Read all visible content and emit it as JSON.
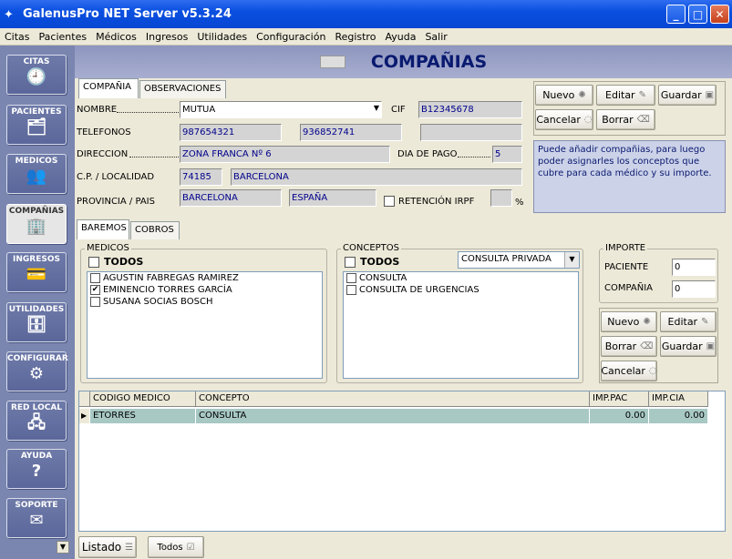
{
  "window": {
    "title": "GalenusPro NET Server v5.3.24"
  },
  "menu": [
    "Citas",
    "Pacientes",
    "Médicos",
    "Ingresos",
    "Utilidades",
    "Configuración",
    "Registro",
    "Ayuda",
    "Salir"
  ],
  "sidebar": [
    {
      "label": "CITAS",
      "icon": "clock-icon",
      "glyph": "🕘"
    },
    {
      "label": "PACIENTES",
      "icon": "patients-icon",
      "glyph": "🗂"
    },
    {
      "label": "MEDICOS",
      "icon": "doctors-icon",
      "glyph": "👥"
    },
    {
      "label": "COMPAÑIAS",
      "icon": "building-icon",
      "glyph": "🏢"
    },
    {
      "label": "INGRESOS",
      "icon": "money-icon",
      "glyph": "💳"
    },
    {
      "label": "UTILIDADES",
      "icon": "utilities-icon",
      "glyph": "🗄"
    },
    {
      "label": "CONFIGURAR",
      "icon": "gears-icon",
      "glyph": "⚙"
    },
    {
      "label": "RED LOCAL",
      "icon": "network-icon",
      "glyph": "🖧"
    },
    {
      "label": "AYUDA",
      "icon": "help-icon",
      "glyph": "?"
    },
    {
      "label": "SOPORTE",
      "icon": "support-icon",
      "glyph": "✉"
    }
  ],
  "header": {
    "title": "COMPAÑIAS"
  },
  "tabs_top": [
    "COMPAÑIA",
    "OBSERVACIONES"
  ],
  "form": {
    "nombre_label": "NOMBRE",
    "nombre": "MUTUA",
    "cif_label": "CIF",
    "cif": "B12345678",
    "telefonos_label": "TELEFONOS",
    "tel1": "987654321",
    "tel2": "936852741",
    "tel3": "",
    "direccion_label": "DIRECCION",
    "direccion": "ZONA FRANCA Nº 6",
    "diapago_label": "DIA DE PAGO",
    "diapago": "5",
    "cp_label": "C.P. / LOCALIDAD",
    "cp": "74185",
    "localidad": "BARCELONA",
    "provincia_label": "PROVINCIA / PAIS",
    "provincia": "BARCELONA",
    "pais": "ESPAÑA",
    "irpf_label": "RETENCIÓN IRPF",
    "irpf_value": "",
    "pct": "%"
  },
  "buttons_top": {
    "nuevo": "Nuevo",
    "editar": "Editar",
    "guardar": "Guardar",
    "cancelar": "Cancelar",
    "borrar": "Borrar"
  },
  "info": "Puede añadir compañias, para luego poder asignarles los conceptos que cubre para cada médico y su importe.",
  "tabs_bottom": [
    "BAREMOS",
    "COBROS"
  ],
  "medicos": {
    "title": "MEDICOS",
    "todos": "TODOS",
    "items": [
      {
        "name": "AGUSTIN  FABREGAS RAMIREZ",
        "checked": false
      },
      {
        "name": "EMINENCIO TORRES GARCÍA",
        "checked": true
      },
      {
        "name": "SUSANA  SOCIAS BOSCH",
        "checked": false
      }
    ]
  },
  "conceptos": {
    "title": "CONCEPTOS",
    "todos": "TODOS",
    "select": "CONSULTA PRIVADA",
    "items": [
      {
        "name": "CONSULTA",
        "checked": false
      },
      {
        "name": "CONSULTA DE URGENCIAS",
        "checked": false
      }
    ]
  },
  "importe": {
    "title": "IMPORTE",
    "paciente_label": "PACIENTE",
    "paciente": "0",
    "compania_label": "COMPAÑIA",
    "compania": "0"
  },
  "buttons_bottom": {
    "nuevo": "Nuevo",
    "editar": "Editar",
    "borrar": "Borrar",
    "guardar": "Guardar",
    "cancelar": "Cancelar"
  },
  "grid": {
    "columns": [
      "CODIGO MEDICO",
      "CONCEPTO",
      "IMP.PAC",
      "IMP.CIA"
    ],
    "rows": [
      [
        "ETORRES",
        "CONSULTA",
        "0.00",
        "0.00"
      ]
    ]
  },
  "bottom": {
    "listado": "Listado",
    "todos": "Todos"
  }
}
